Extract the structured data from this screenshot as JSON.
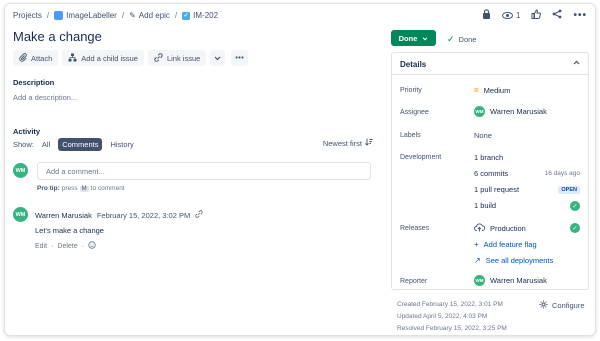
{
  "breadcrumb": {
    "root": "Projects",
    "project": "ImageLabeller",
    "epic": "Add epic",
    "issue_key": "IM-202",
    "separator": "/"
  },
  "top_actions": {
    "watch_count": "1",
    "icons": [
      "lock-icon",
      "eye-icon",
      "thumbs-up-icon",
      "share-icon",
      "more-icon"
    ]
  },
  "issue": {
    "title": "Make a change"
  },
  "toolbar": {
    "attach": "Attach",
    "add_child": "Add a child issue",
    "link_issue": "Link issue"
  },
  "description": {
    "label": "Description",
    "placeholder": "Add a description..."
  },
  "activity": {
    "label": "Activity",
    "show_label": "Show:",
    "filters": [
      "All",
      "Comments",
      "History"
    ],
    "active_filter": "Comments",
    "sort": "Newest first",
    "comment_placeholder": "Add a comment...",
    "protip_prefix": "Pro tip:",
    "protip_press": "press",
    "protip_key": "M",
    "protip_suffix": "to comment"
  },
  "comment": {
    "avatar": "WM",
    "author": "Warren Marusiak",
    "date": "February 15, 2022, 3:02 PM",
    "body": "Let's make a change",
    "edit": "Edit",
    "dot": "·",
    "delete": "Delete"
  },
  "status": {
    "button": "Done",
    "resolution": "Done"
  },
  "details": {
    "title": "Details",
    "priority_label": "Priority",
    "priority": "Medium",
    "assignee_label": "Assignee",
    "assignee_avatar": "WM",
    "assignee": "Warren Marusiak",
    "labels_label": "Labels",
    "labels": "None",
    "development_label": "Development",
    "branch": "1 branch",
    "commits": "6 commits",
    "commits_age": "16 days ago",
    "pull_request": "1 pull request",
    "pr_status": "OPEN",
    "build": "1 build",
    "releases_label": "Releases",
    "release_env": "Production",
    "add_feature_flag": "Add feature flag",
    "see_deployments": "See all deployments",
    "reporter_label": "Reporter",
    "reporter_avatar": "WM",
    "reporter": "Warren Marusiak"
  },
  "meta": {
    "created": "Created February 15, 2022, 3:01 PM",
    "updated": "Updated April 5, 2022, 4:03 PM",
    "resolved": "Resolved February 15, 2022, 3:25 PM",
    "configure": "Configure"
  },
  "colors": {
    "done_green": "#00875a",
    "avatar_green": "#36b37e",
    "link_blue": "#0052cc",
    "priority_orange": "#ff8b00"
  }
}
